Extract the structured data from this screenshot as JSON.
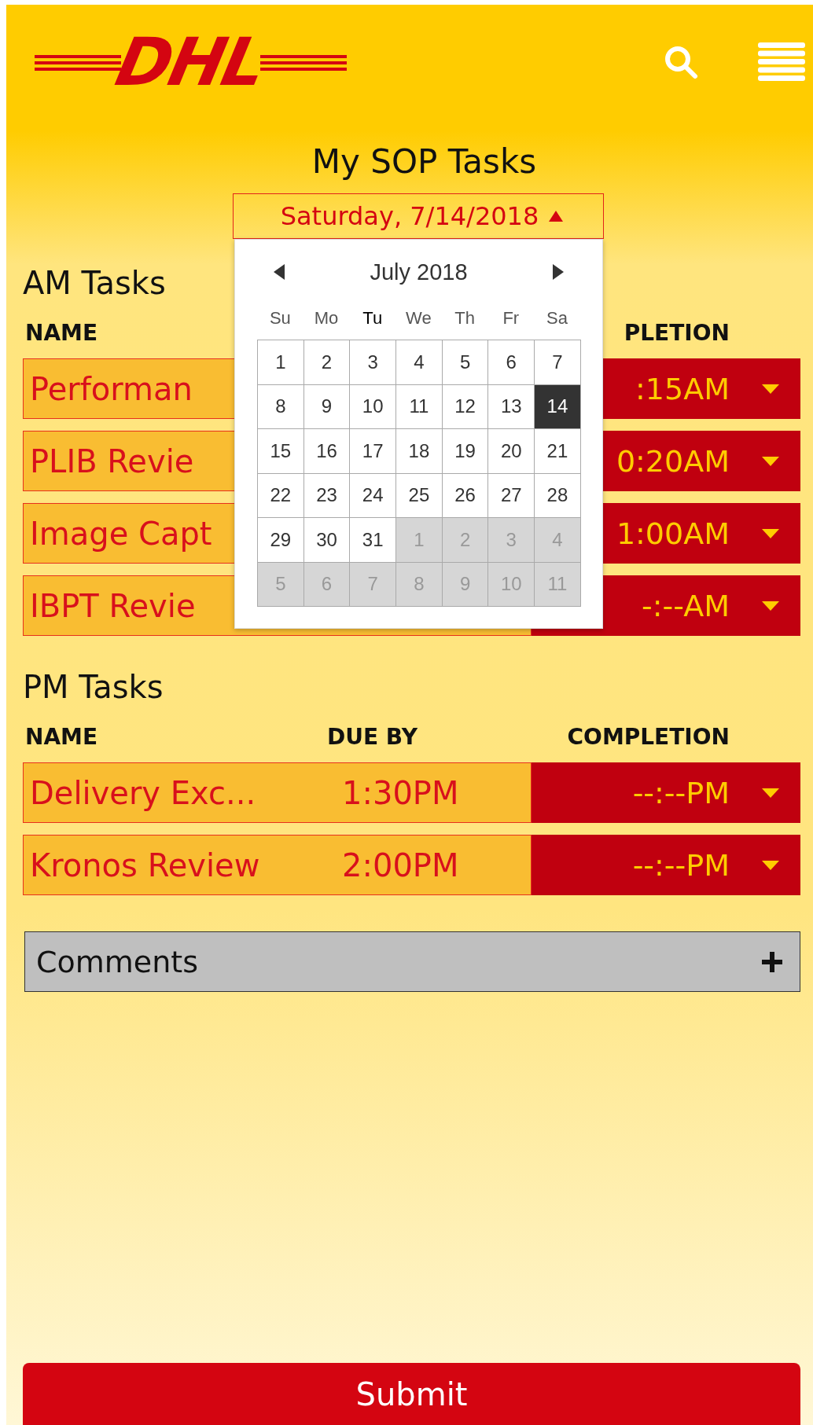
{
  "header": {
    "logo": "DHL"
  },
  "title": "My SOP Tasks",
  "date_picker": {
    "value": "Saturday, 7/14/2018",
    "expanded": true,
    "calendar": {
      "month": "July 2018",
      "weekdays": [
        {
          "label": "Su",
          "current": false
        },
        {
          "label": "Mo",
          "current": false
        },
        {
          "label": "Tu",
          "current": true
        },
        {
          "label": "We",
          "current": false
        },
        {
          "label": "Th",
          "current": false
        },
        {
          "label": "Fr",
          "current": false
        },
        {
          "label": "Sa",
          "current": false
        }
      ],
      "days": [
        {
          "label": "1",
          "selected": false,
          "other_month": false
        },
        {
          "label": "2",
          "selected": false,
          "other_month": false
        },
        {
          "label": "3",
          "selected": false,
          "other_month": false
        },
        {
          "label": "4",
          "selected": false,
          "other_month": false
        },
        {
          "label": "5",
          "selected": false,
          "other_month": false
        },
        {
          "label": "6",
          "selected": false,
          "other_month": false
        },
        {
          "label": "7",
          "selected": false,
          "other_month": false
        },
        {
          "label": "8",
          "selected": false,
          "other_month": false
        },
        {
          "label": "9",
          "selected": false,
          "other_month": false
        },
        {
          "label": "10",
          "selected": false,
          "other_month": false
        },
        {
          "label": "11",
          "selected": false,
          "other_month": false
        },
        {
          "label": "12",
          "selected": false,
          "other_month": false
        },
        {
          "label": "13",
          "selected": false,
          "other_month": false
        },
        {
          "label": "14",
          "selected": true,
          "other_month": false
        },
        {
          "label": "15",
          "selected": false,
          "other_month": false
        },
        {
          "label": "16",
          "selected": false,
          "other_month": false
        },
        {
          "label": "17",
          "selected": false,
          "other_month": false
        },
        {
          "label": "18",
          "selected": false,
          "other_month": false
        },
        {
          "label": "19",
          "selected": false,
          "other_month": false
        },
        {
          "label": "20",
          "selected": false,
          "other_month": false
        },
        {
          "label": "21",
          "selected": false,
          "other_month": false
        },
        {
          "label": "22",
          "selected": false,
          "other_month": false
        },
        {
          "label": "23",
          "selected": false,
          "other_month": false
        },
        {
          "label": "24",
          "selected": false,
          "other_month": false
        },
        {
          "label": "25",
          "selected": false,
          "other_month": false
        },
        {
          "label": "26",
          "selected": false,
          "other_month": false
        },
        {
          "label": "27",
          "selected": false,
          "other_month": false
        },
        {
          "label": "28",
          "selected": false,
          "other_month": false
        },
        {
          "label": "29",
          "selected": false,
          "other_month": false
        },
        {
          "label": "30",
          "selected": false,
          "other_month": false
        },
        {
          "label": "31",
          "selected": false,
          "other_month": false
        },
        {
          "label": "1",
          "selected": false,
          "other_month": true
        },
        {
          "label": "2",
          "selected": false,
          "other_month": true
        },
        {
          "label": "3",
          "selected": false,
          "other_month": true
        },
        {
          "label": "4",
          "selected": false,
          "other_month": true
        },
        {
          "label": "5",
          "selected": false,
          "other_month": true
        },
        {
          "label": "6",
          "selected": false,
          "other_month": true
        },
        {
          "label": "7",
          "selected": false,
          "other_month": true
        },
        {
          "label": "8",
          "selected": false,
          "other_month": true
        },
        {
          "label": "9",
          "selected": false,
          "other_month": true
        },
        {
          "label": "10",
          "selected": false,
          "other_month": true
        },
        {
          "label": "11",
          "selected": false,
          "other_month": true
        }
      ]
    }
  },
  "sections": [
    {
      "title": "AM Tasks",
      "columns": {
        "name": "NAME",
        "completion": "PLETION"
      },
      "rows": [
        {
          "name": "Performan",
          "completion": ":15AM"
        },
        {
          "name": "PLIB Revie",
          "completion": "0:20AM"
        },
        {
          "name": "Image Capt",
          "completion": "1:00AM"
        },
        {
          "name": "IBPT Revie",
          "completion": "-:--AM"
        }
      ]
    },
    {
      "title": "PM Tasks",
      "columns": {
        "name": "NAME",
        "due_by": "DUE BY",
        "completion": "COMPLETION"
      },
      "rows": [
        {
          "name": "Delivery Exc...",
          "due_by": "1:30PM",
          "completion": "--:--PM"
        },
        {
          "name": "Kronos Review",
          "due_by": "2:00PM",
          "completion": "--:--PM"
        }
      ]
    }
  ],
  "comments": {
    "label": "Comments",
    "expanded": false
  },
  "submit": "Submit"
}
